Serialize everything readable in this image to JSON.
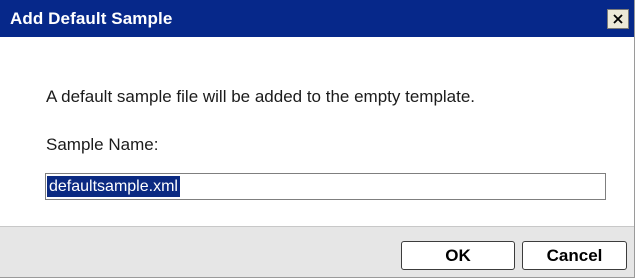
{
  "window": {
    "title": "Add Default Sample",
    "close_icon": "close-icon"
  },
  "body": {
    "message": "A default sample file will be added to the empty template.",
    "sample_name_label": "Sample Name:",
    "sample_name_value": "defaultsample.xml"
  },
  "footer": {
    "ok_label": "OK",
    "cancel_label": "Cancel"
  },
  "colors": {
    "titlebar": "#06288a",
    "selection": "#0b2a82",
    "footer_bg": "#e6e6e6"
  }
}
